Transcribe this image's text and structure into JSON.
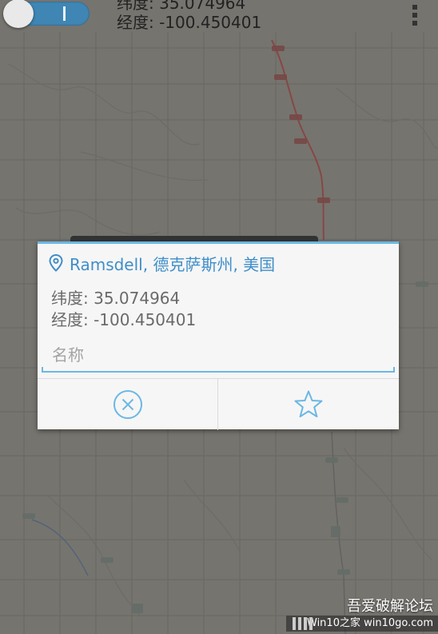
{
  "header": {
    "latitude_text": "纬度: 35.074964",
    "longitude_text": "经度: -100.450401"
  },
  "dialog": {
    "location_title": "Ramsdell, 德克萨斯州, 美国",
    "latitude_text": "纬度: 35.074964",
    "longitude_text": "经度: -100.450401",
    "name_placeholder": "名称",
    "cancel_icon": "close-circle-icon",
    "favorite_icon": "star-icon"
  },
  "watermark": {
    "line1": "吾爱破解论坛",
    "line2": "Win10之家 win10go.com"
  },
  "colors": {
    "accent": "#3f8ec8",
    "divider": "#6cb7e4",
    "toggle": "#3f86b5",
    "road": "#b44a4a"
  }
}
